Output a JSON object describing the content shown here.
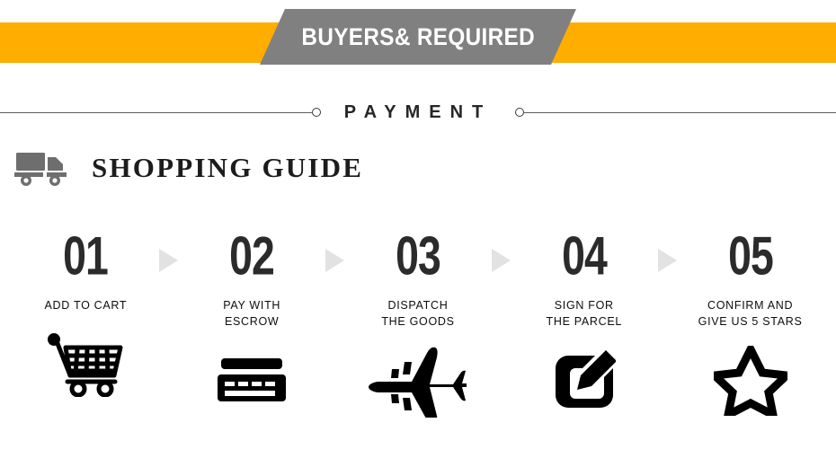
{
  "banner": {
    "title": "BUYERS& REQUIRED",
    "orange_color": "#FFAE00",
    "gray_color": "#808080",
    "title_color": "#FFFFFF"
  },
  "divider": {
    "label": "PAYMENT",
    "line_color": "#5D5D5D",
    "dot_icon_left": "circle-dot-icon",
    "dot_icon_right": "circle-dot-icon"
  },
  "guide": {
    "icon": "delivery-truck-icon",
    "title": "SHOPPING GUIDE",
    "title_color": "#1C1C1C",
    "icon_color": "#6E6E6E"
  },
  "steps": [
    {
      "number": "01",
      "label": "ADD TO CART",
      "icon": "shopping-cart-icon"
    },
    {
      "number": "02",
      "label": "PAY WITH\nESCROW",
      "icon": "credit-card-icon"
    },
    {
      "number": "03",
      "label": "DISPATCH\nTHE GOODS",
      "icon": "airplane-icon"
    },
    {
      "number": "04",
      "label": "SIGN FOR\nTHE PARCEL",
      "icon": "edit-pencil-square-icon"
    },
    {
      "number": "05",
      "label": "CONFIRM AND\nGIVE US 5 STARS",
      "icon": "star-outline-icon"
    }
  ],
  "arrows": {
    "icon": "triangle-right-icon",
    "color": "#E2E2E2",
    "count": 4
  }
}
